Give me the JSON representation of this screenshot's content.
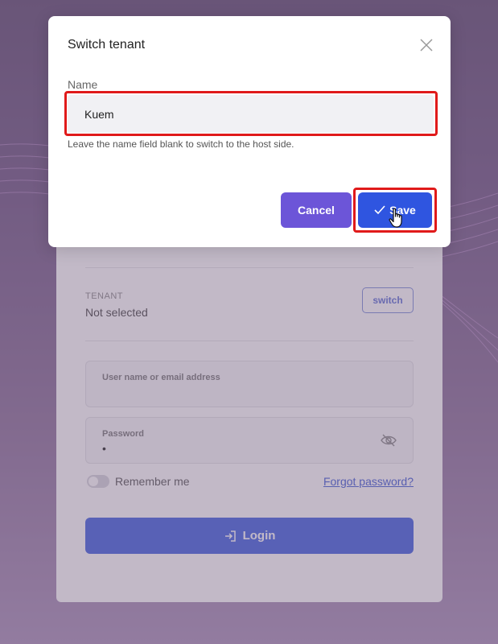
{
  "dialog": {
    "title": "Switch tenant",
    "name_label": "Name",
    "name_value": "Kuem",
    "hint": "Leave the name field blank to switch to the host side.",
    "cancel_label": "Cancel",
    "save_label": "Save",
    "close_icon": "close-icon",
    "save_icon": "check-icon"
  },
  "login": {
    "tenant_caption": "TENANT",
    "tenant_value": "Not selected",
    "switch_label": "switch",
    "username_label": "User name or email address",
    "password_label": "Password",
    "password_value": "•",
    "remember_label": "Remember me",
    "forgot_label": "Forgot password?",
    "login_label": "Login",
    "login_icon": "login-icon",
    "eye_icon": "eye-slash-icon"
  },
  "colors": {
    "accent": "#2f55e0",
    "cancel": "#6c55d8",
    "highlight": "#e01a1a"
  }
}
